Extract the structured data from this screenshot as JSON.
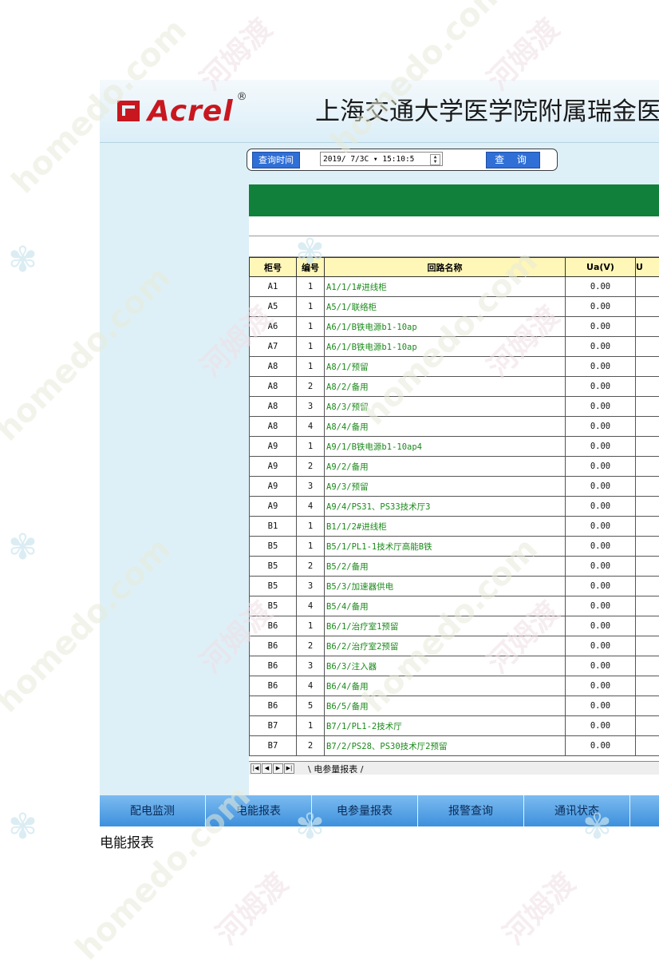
{
  "header": {
    "logo_text": "Acrel",
    "logo_reg": "®",
    "title": "上海交通大学医学院附属瑞金医"
  },
  "query": {
    "label": "查询时间",
    "date_value": "2019/ 7/3C ▾ 15:10:5",
    "button": "查 询"
  },
  "table": {
    "headers": [
      "柜号",
      "编号",
      "回路名称",
      "Ua(V)",
      "U"
    ],
    "rows": [
      [
        "A1",
        "1",
        "A1/1/1#进线柜",
        "0.00"
      ],
      [
        "A5",
        "1",
        "A5/1/联络柜",
        "0.00"
      ],
      [
        "A6",
        "1",
        "A6/1/B铁电源b1-10ap",
        "0.00"
      ],
      [
        "A7",
        "1",
        "A6/1/B铁电源b1-10ap",
        "0.00"
      ],
      [
        "A8",
        "1",
        "A8/1/预留",
        "0.00"
      ],
      [
        "A8",
        "2",
        "A8/2/备用",
        "0.00"
      ],
      [
        "A8",
        "3",
        "A8/3/预留",
        "0.00"
      ],
      [
        "A8",
        "4",
        "A8/4/备用",
        "0.00"
      ],
      [
        "A9",
        "1",
        "A9/1/B铁电源b1-10ap4",
        "0.00"
      ],
      [
        "A9",
        "2",
        "A9/2/备用",
        "0.00"
      ],
      [
        "A9",
        "3",
        "A9/3/预留",
        "0.00"
      ],
      [
        "A9",
        "4",
        "A9/4/PS31、PS33技术厅3",
        "0.00"
      ],
      [
        "B1",
        "1",
        "B1/1/2#进线柜",
        "0.00"
      ],
      [
        "B5",
        "1",
        "B5/1/PL1-1技术厅高能B铁",
        "0.00"
      ],
      [
        "B5",
        "2",
        "B5/2/备用",
        "0.00"
      ],
      [
        "B5",
        "3",
        "B5/3/加速器供电",
        "0.00"
      ],
      [
        "B5",
        "4",
        "B5/4/备用",
        "0.00"
      ],
      [
        "B6",
        "1",
        "B6/1/治疗室1预留",
        "0.00"
      ],
      [
        "B6",
        "2",
        "B6/2/治疗室2预留",
        "0.00"
      ],
      [
        "B6",
        "3",
        "B6/3/注入器",
        "0.00"
      ],
      [
        "B6",
        "4",
        "B6/4/备用",
        "0.00"
      ],
      [
        "B6",
        "5",
        "B6/5/备用",
        "0.00"
      ],
      [
        "B7",
        "1",
        "B7/1/PL1-2技术厅",
        "0.00"
      ],
      [
        "B7",
        "2",
        "B7/2/PS28、PS30技术厅2预留",
        "0.00"
      ]
    ]
  },
  "sheet_tab": "电参量报表",
  "bottom_nav": [
    "配电监测",
    "电能报表",
    "电参量报表",
    "报警查询",
    "通讯状态"
  ],
  "caption": "电能报表",
  "colors": {
    "report_header": "#10803b",
    "nav": "#3b8fdc",
    "logo": "#c8171f",
    "circuit_text": "#1b8a1b"
  }
}
